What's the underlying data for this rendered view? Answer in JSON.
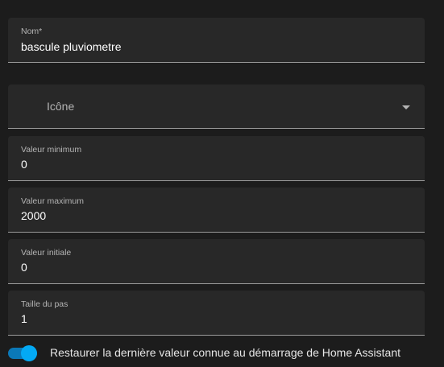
{
  "fields": {
    "name": {
      "label": "Nom*",
      "value": "bascule pluviometre"
    },
    "icon": {
      "label": "Icône"
    },
    "min": {
      "label": "Valeur minimum",
      "value": "0"
    },
    "max": {
      "label": "Valeur maximum",
      "value": "2000"
    },
    "initial": {
      "label": "Valeur initiale",
      "value": "0"
    },
    "step": {
      "label": "Taille du pas",
      "value": "1"
    }
  },
  "restore_toggle": {
    "label": "Restaurer la dernière valeur connue au démarrage de Home Assistant",
    "checked": true
  },
  "icons": {
    "dropdown": "chevron-down-icon"
  },
  "colors": {
    "accent": "#03a9f4",
    "field_background": "#282828",
    "page_background": "#1c1c1c"
  }
}
